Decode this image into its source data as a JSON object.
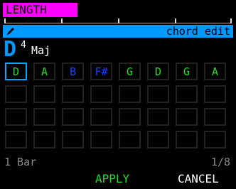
{
  "header": {
    "title": "LENGTH",
    "title_bg": "#ff00ff"
  },
  "mode": {
    "icon": "pencil-icon",
    "label": "chord edit",
    "bar_color": "#0099ff"
  },
  "chord": {
    "root": "D",
    "octave": "4",
    "quality": "Maj"
  },
  "grid": {
    "rows": 4,
    "columns": 8,
    "selected_index": 0,
    "cells": [
      {
        "label": "D",
        "color": "#22dd22"
      },
      {
        "label": "A",
        "color": "#22dd22"
      },
      {
        "label": "B",
        "color": "#1144ff"
      },
      {
        "label": "F#",
        "color": "#1144ff"
      },
      {
        "label": "G",
        "color": "#22dd22"
      },
      {
        "label": "D",
        "color": "#22dd22"
      },
      {
        "label": "G",
        "color": "#22dd22"
      },
      {
        "label": "A",
        "color": "#22dd22"
      }
    ]
  },
  "footer": {
    "bar_count": "1 Bar",
    "page": "1/8",
    "apply_label": "APPLY",
    "cancel_label": "CANCEL",
    "apply_color": "#22dd22"
  }
}
